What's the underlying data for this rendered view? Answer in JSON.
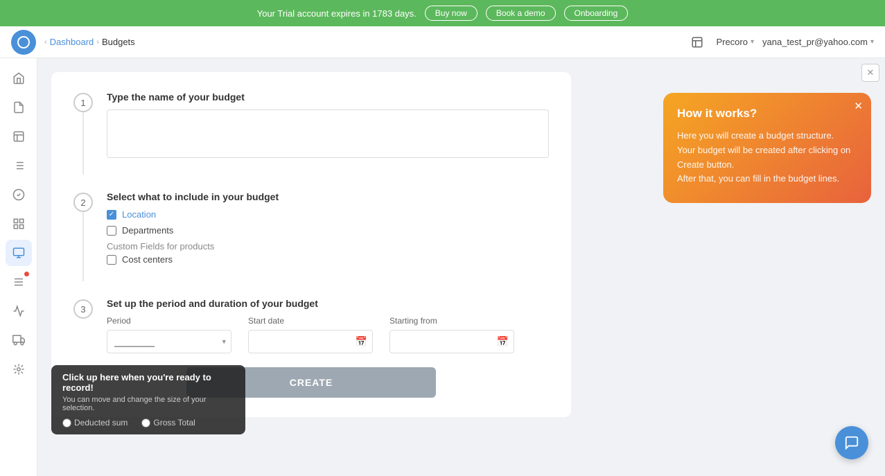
{
  "banner": {
    "text": "Your Trial account expires in 1783 days.",
    "buy_label": "Buy now",
    "demo_label": "Book a demo",
    "onboarding_label": "Onboarding"
  },
  "header": {
    "breadcrumb_home": "Dashboard",
    "breadcrumb_current": "Budgets",
    "org_name": "Precoro",
    "user_email": "yana_test_pr@yahoo.com"
  },
  "sidebar": {
    "items": [
      {
        "name": "home",
        "icon": "⌂"
      },
      {
        "name": "requests",
        "icon": "≡"
      },
      {
        "name": "orders",
        "icon": "📋"
      },
      {
        "name": "invoices",
        "icon": "🗒"
      },
      {
        "name": "approvals",
        "icon": "✓"
      },
      {
        "name": "reports",
        "icon": "▦"
      },
      {
        "name": "budgets",
        "icon": "▤"
      },
      {
        "name": "list",
        "icon": "≡"
      },
      {
        "name": "analytics",
        "icon": "📊"
      },
      {
        "name": "delivery",
        "icon": "🚚"
      },
      {
        "name": "integrations",
        "icon": "▣"
      }
    ]
  },
  "form": {
    "step1": {
      "number": "1",
      "title": "Type the name of your budget",
      "input_placeholder": ""
    },
    "step2": {
      "number": "2",
      "title": "Select what to include in your budget",
      "options": [
        {
          "label": "Location",
          "checked": true
        },
        {
          "label": "Departments",
          "checked": false
        }
      ],
      "custom_fields_label": "Custom Fields for products",
      "custom_options": [
        {
          "label": "Cost centers",
          "checked": false
        }
      ]
    },
    "step3": {
      "number": "3",
      "title": "Set up the period and duration of your budget",
      "period_label": "Period",
      "start_date_label": "Start date",
      "starting_from_label": "Starting from",
      "period_placeholder": "________",
      "deducted_label": "Deducted sum",
      "gross_total_label": "Gross Total"
    },
    "create_btn": "CREATE"
  },
  "how_it_works": {
    "title": "How it works?",
    "body": "Here you will create a budget structure.\nYour budget will be created after clicking on Create button.\nAfter that, you can fill in the budget lines."
  },
  "tooltip": {
    "title": "Click up here when you're ready to record!",
    "subtitle": "You can move and change the size of your selection."
  }
}
